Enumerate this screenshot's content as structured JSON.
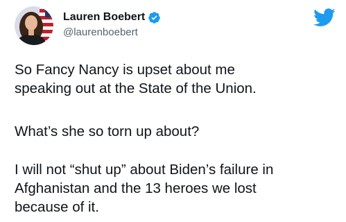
{
  "tweet": {
    "author": {
      "display_name": "Lauren Boebert",
      "handle": "@laurenboebert",
      "verified": true,
      "avatar_icon": "profile-photo"
    },
    "logo_icon": "twitter-bird-icon",
    "accent_color": "#1d9bf0",
    "paragraphs": [
      [
        "So Fancy Nancy is upset about me",
        "speaking out at the State of the Union."
      ],
      [
        "What’s she so torn up about?"
      ],
      [
        "I will not “shut up” about Biden’s failure in",
        "Afghanistan and the 13 heroes we lost",
        "because of it."
      ]
    ]
  }
}
